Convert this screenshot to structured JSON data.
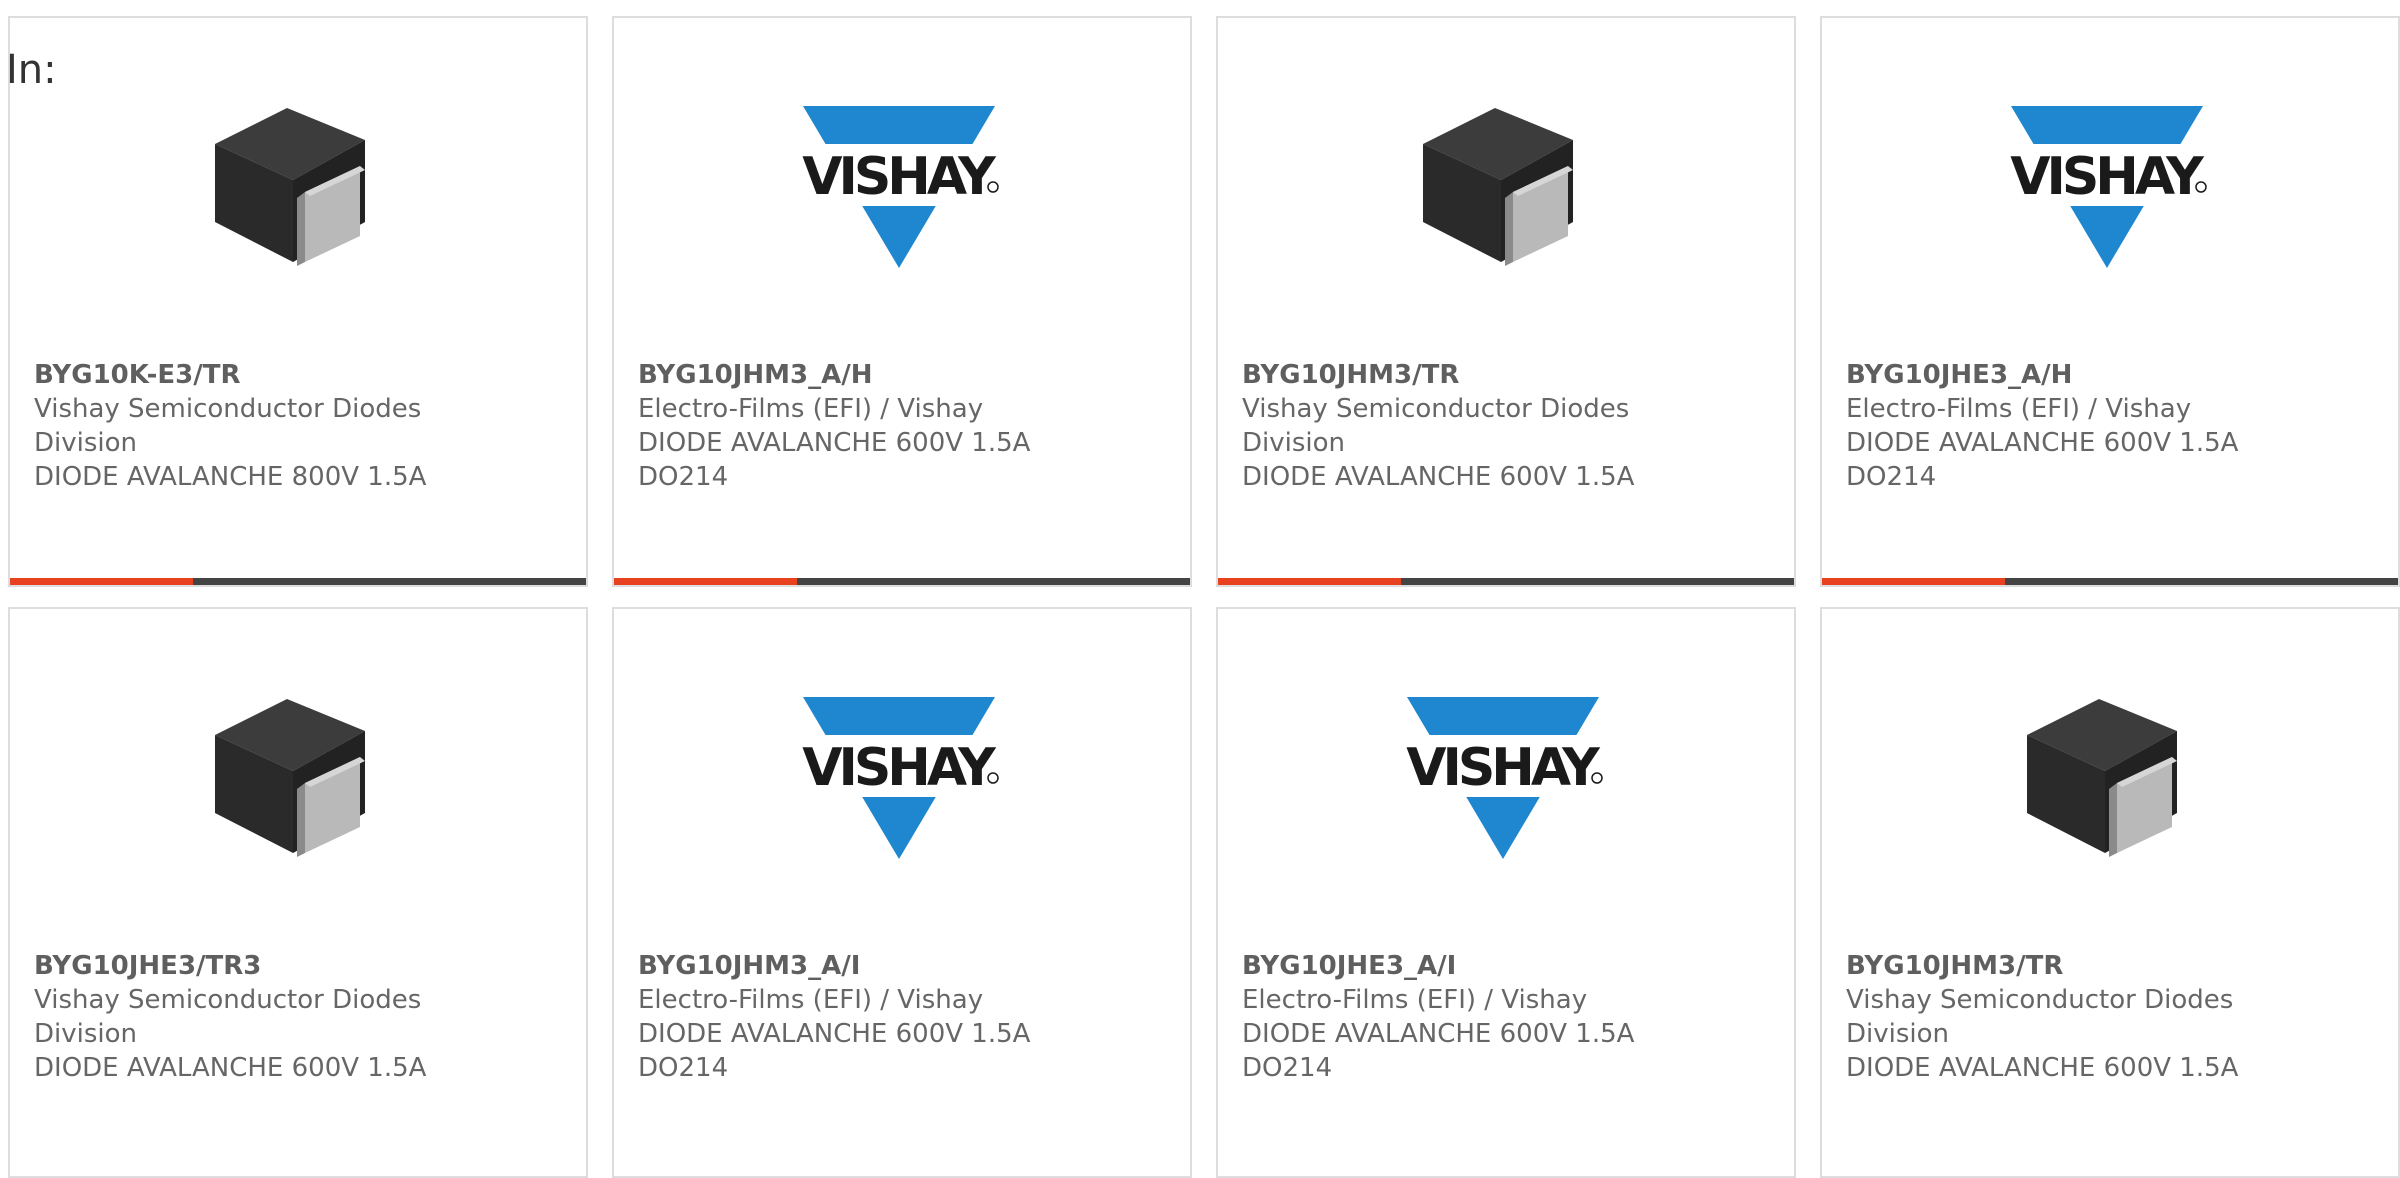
{
  "filter": {
    "label": "In:"
  },
  "colors": {
    "accent": "#e8411f",
    "bar": "#444444",
    "vishay_blue": "#1e87cf",
    "text": "#666666"
  },
  "products": [
    {
      "part_number": "BYG10K-E3/TR",
      "manufacturer": "Vishay Semiconductor Diodes Division",
      "description": "DIODE AVALANCHE 800V 1.5A",
      "image": "diode-package-icon"
    },
    {
      "part_number": "BYG10JHM3_A/H",
      "manufacturer": "Electro-Films (EFI) / Vishay",
      "description": "DIODE AVALANCHE 600V 1.5A DO214",
      "image": "vishay-logo",
      "logo_text": "VISHAY"
    },
    {
      "part_number": "BYG10JHM3/TR",
      "manufacturer": "Vishay Semiconductor Diodes Division",
      "description": "DIODE AVALANCHE 600V 1.5A",
      "image": "diode-package-icon"
    },
    {
      "part_number": "BYG10JHE3_A/H",
      "manufacturer": "Electro-Films (EFI) / Vishay",
      "description": "DIODE AVALANCHE 600V 1.5A DO214",
      "image": "vishay-logo",
      "logo_text": "VISHAY"
    },
    {
      "part_number": "BYG10JHE3/TR3",
      "manufacturer": "Vishay Semiconductor Diodes Division",
      "description": "DIODE AVALANCHE 600V 1.5A",
      "image": "diode-package-icon"
    },
    {
      "part_number": "BYG10JHM3_A/I",
      "manufacturer": "Electro-Films (EFI) / Vishay",
      "description": "DIODE AVALANCHE 600V 1.5A DO214",
      "image": "vishay-logo",
      "logo_text": "VISHAY"
    },
    {
      "part_number": "BYG10JHE3_A/I",
      "manufacturer": "Electro-Films (EFI) / Vishay",
      "description": "DIODE AVALANCHE 600V 1.5A DO214",
      "image": "vishay-logo",
      "logo_text": "VISHAY"
    },
    {
      "part_number": "BYG10JHM3/TR",
      "manufacturer": "Vishay Semiconductor Diodes Division",
      "description": "DIODE AVALANCHE 600V 1.5A",
      "image": "diode-package-icon"
    }
  ]
}
